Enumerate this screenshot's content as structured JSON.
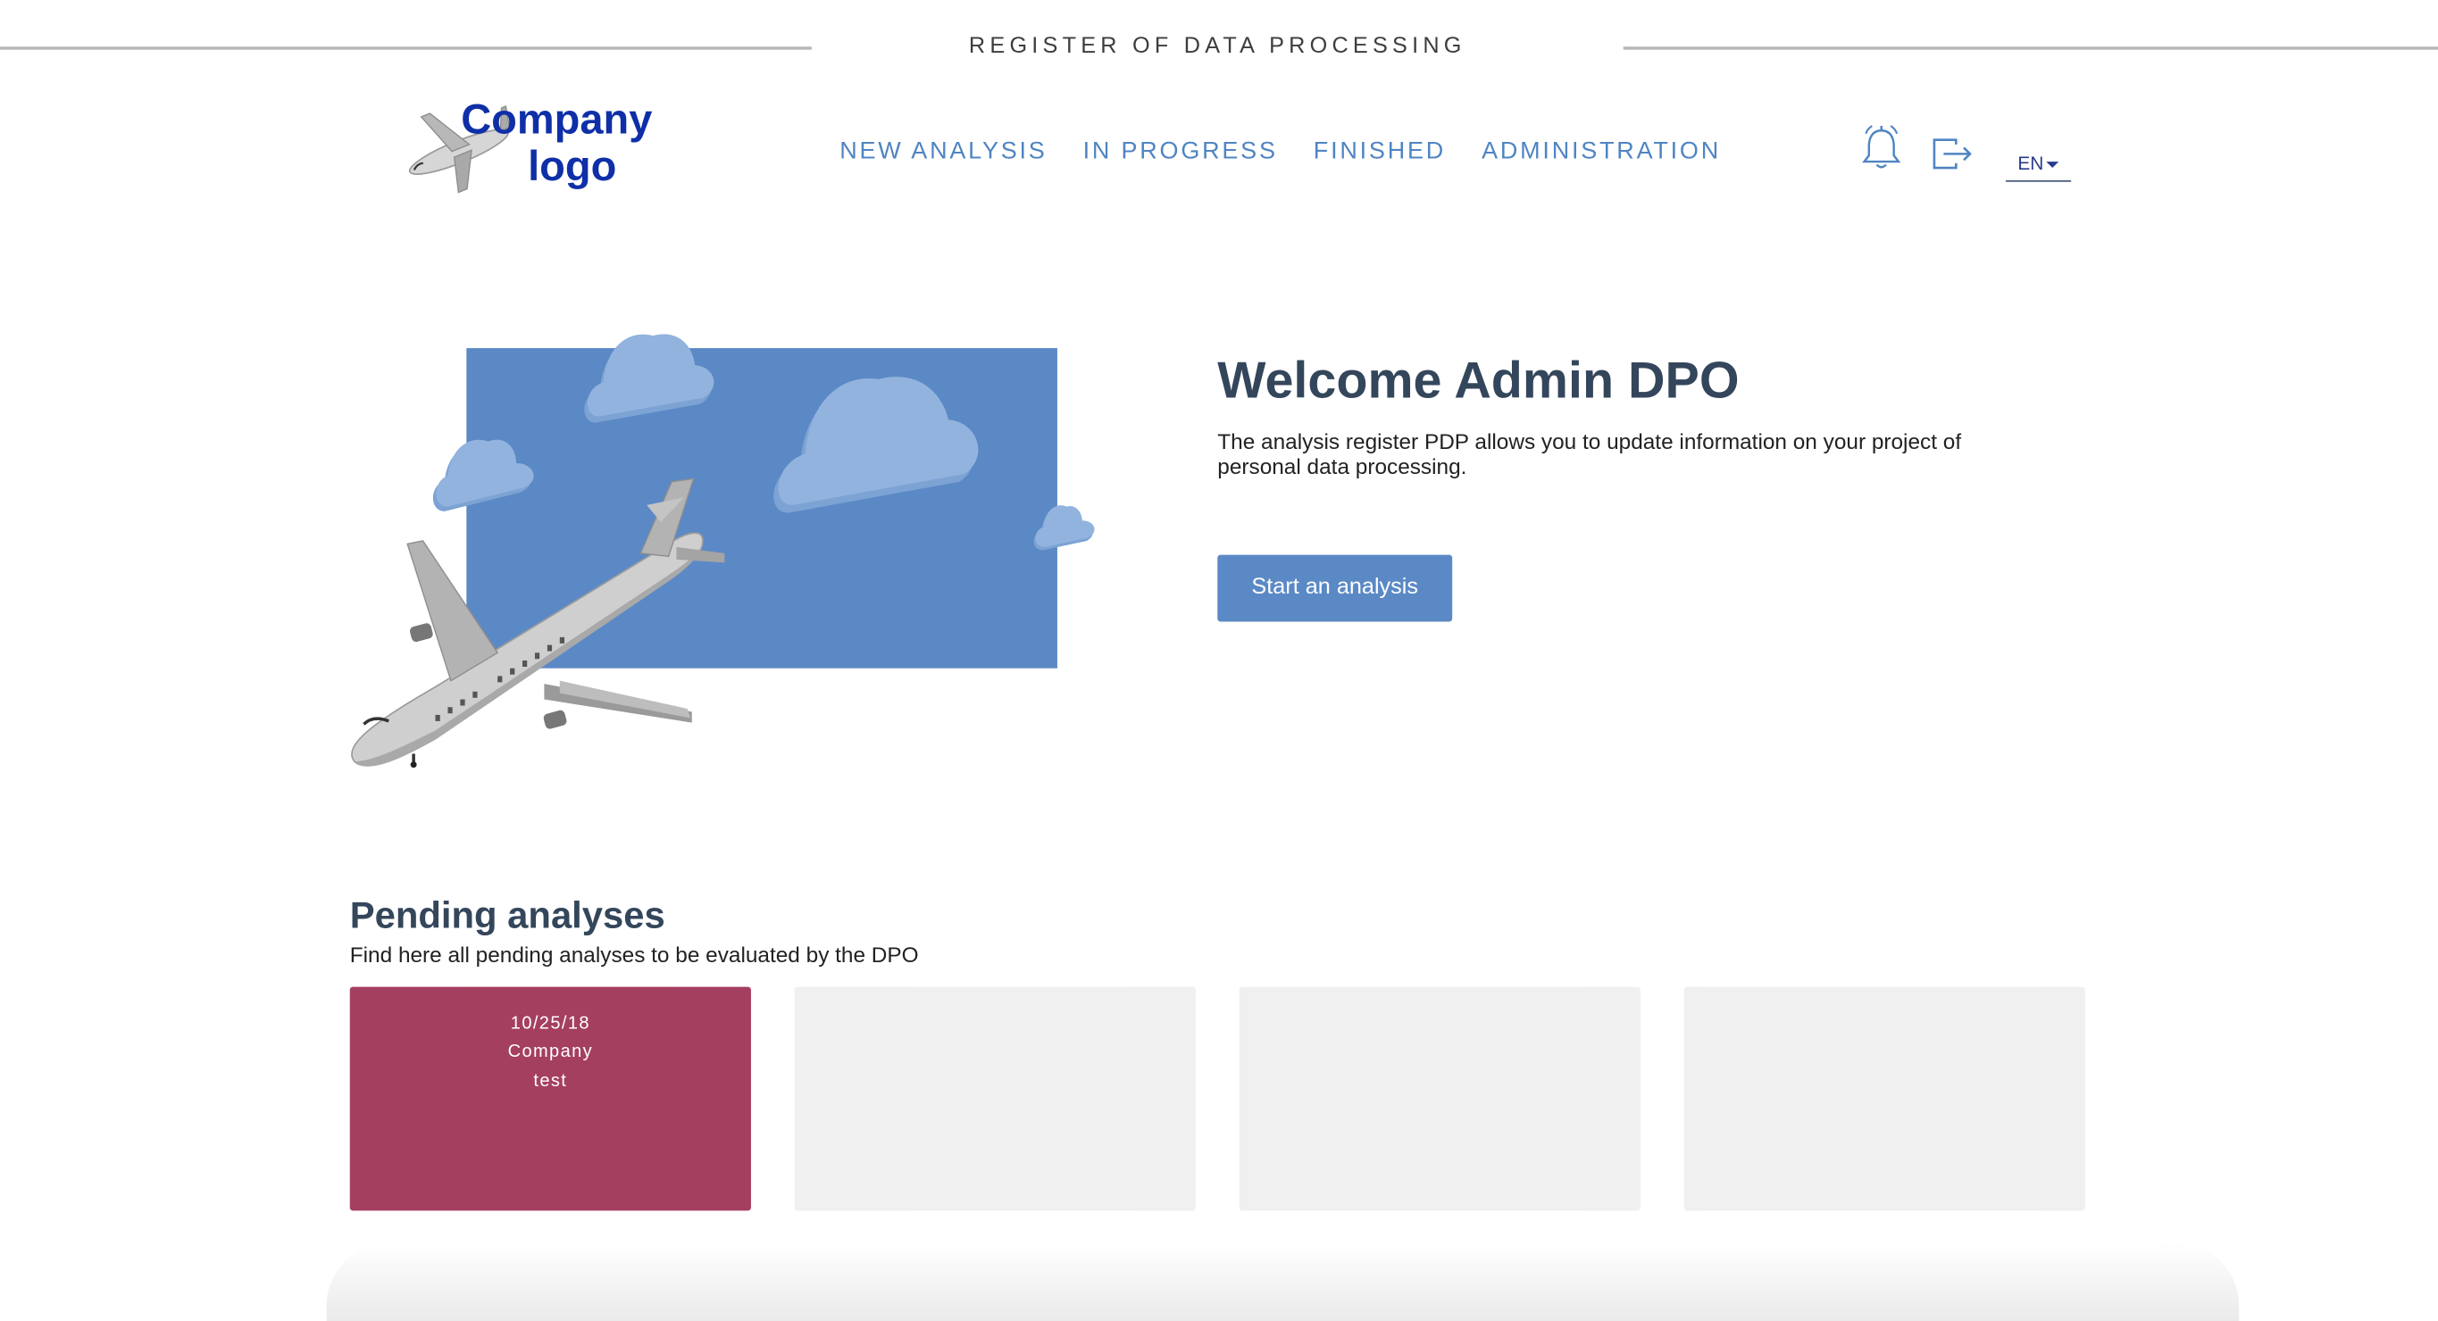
{
  "banner": {
    "title": "REGISTER OF DATA PROCESSING"
  },
  "logo": {
    "line1": "Company",
    "line2": "logo"
  },
  "nav": {
    "items": [
      {
        "label": "NEW ANALYSIS"
      },
      {
        "label": "IN PROGRESS"
      },
      {
        "label": "FINISHED"
      },
      {
        "label": "ADMINISTRATION"
      }
    ]
  },
  "header_icons": [
    "bell-icon",
    "logout-icon"
  ],
  "language": {
    "selected": "EN"
  },
  "colors": {
    "accent": "#5b89c5",
    "nav_text": "#4f84c2",
    "heading": "#34465b",
    "pending_card": "#a53f60",
    "empty_card": "#f0f0f0",
    "logo_text": "#0f2fa8"
  },
  "welcome": {
    "title": "Welcome Admin DPO",
    "text": "The analysis register PDP allows you to update information on your project of personal data processing.",
    "button_label": "Start an analysis"
  },
  "pending": {
    "title": "Pending analyses",
    "subtitle": "Find here all pending analyses to be evaluated by the DPO",
    "cards": [
      {
        "date": "10/25/18",
        "company": "Company",
        "name": "test"
      }
    ]
  }
}
